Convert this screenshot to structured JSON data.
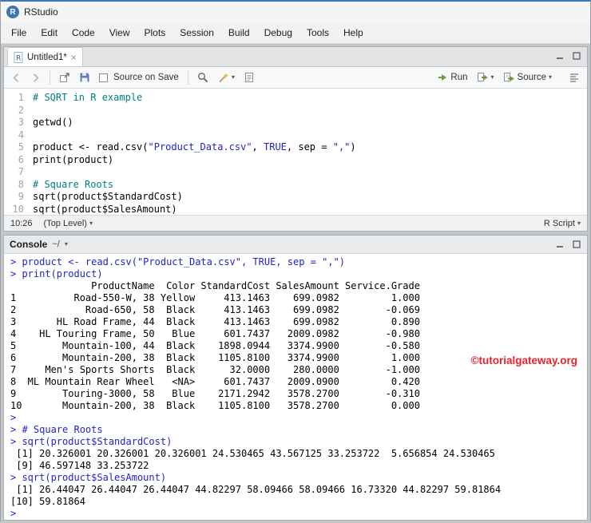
{
  "colors": {
    "accent": "#75aadb",
    "comment": "#008080",
    "code-blue": "#2222cc",
    "green": "#6a9e3a",
    "watermark-red": "#e8222a"
  },
  "window": {
    "title": "RStudio"
  },
  "menu": [
    "File",
    "Edit",
    "Code",
    "View",
    "Plots",
    "Session",
    "Build",
    "Debug",
    "Tools",
    "Help"
  ],
  "source_pane": {
    "tab_label": "Untitled1*",
    "toolbar": {
      "source_on_save": "Source on Save",
      "run": "Run",
      "source": "Source"
    },
    "status": {
      "cursor": "10:26",
      "scope": "(Top Level)",
      "file_type": "R Script"
    },
    "code": [
      {
        "num": "1",
        "seg": [
          {
            "t": "c",
            "x": "# SQRT in R example"
          }
        ]
      },
      {
        "num": "2",
        "seg": []
      },
      {
        "num": "3",
        "seg": [
          {
            "t": "p",
            "x": "getwd()"
          }
        ]
      },
      {
        "num": "4",
        "seg": []
      },
      {
        "num": "5",
        "seg": [
          {
            "t": "p",
            "x": "product <- read.csv("
          },
          {
            "t": "s",
            "x": "\"Product_Data.csv\""
          },
          {
            "t": "p",
            "x": ", "
          },
          {
            "t": "k",
            "x": "TRUE"
          },
          {
            "t": "p",
            "x": ", sep = "
          },
          {
            "t": "s",
            "x": "\",\""
          },
          {
            "t": "p",
            "x": ")"
          }
        ]
      },
      {
        "num": "6",
        "seg": [
          {
            "t": "p",
            "x": "print(product)"
          }
        ]
      },
      {
        "num": "7",
        "seg": []
      },
      {
        "num": "8",
        "seg": [
          {
            "t": "c",
            "x": "# Square Roots"
          }
        ]
      },
      {
        "num": "9",
        "seg": [
          {
            "t": "p",
            "x": "sqrt(product$StandardCost)"
          }
        ]
      },
      {
        "num": "10",
        "seg": [
          {
            "t": "p",
            "x": "sqrt(product$SalesAmount)"
          }
        ]
      }
    ]
  },
  "console": {
    "title": "Console",
    "path": "~/",
    "lines": [
      {
        "t": "in",
        "x": "> product <- read.csv(\"Product_Data.csv\", TRUE, sep = \",\")"
      },
      {
        "t": "in",
        "x": "> print(product)"
      },
      {
        "t": "out",
        "x": "              ProductName  Color StandardCost SalesAmount Service.Grade"
      },
      {
        "t": "out",
        "x": "1          Road-550-W, 38 Yellow     413.1463    699.0982         1.000"
      },
      {
        "t": "out",
        "x": "2            Road-650, 58  Black     413.1463    699.0982        -0.069"
      },
      {
        "t": "out",
        "x": "3       HL Road Frame, 44  Black     413.1463    699.0982         0.890"
      },
      {
        "t": "out",
        "x": "4    HL Touring Frame, 50   Blue     601.7437   2009.0982        -0.980"
      },
      {
        "t": "out",
        "x": "5        Mountain-100, 44  Black    1898.0944   3374.9900        -0.580"
      },
      {
        "t": "out",
        "x": "6        Mountain-200, 38  Black    1105.8100   3374.9900         1.000"
      },
      {
        "t": "out",
        "x": "7     Men's Sports Shorts  Black      32.0000    280.0000        -1.000"
      },
      {
        "t": "out",
        "x": "8  ML Mountain Rear Wheel   <NA>     601.7437   2009.0900         0.420"
      },
      {
        "t": "out",
        "x": "9        Touring-3000, 58   Blue    2171.2942   3578.2700        -0.310"
      },
      {
        "t": "out",
        "x": "10       Mountain-200, 38  Black    1105.8100   3578.2700         0.000"
      },
      {
        "t": "in",
        "x": "> "
      },
      {
        "t": "in",
        "x": "> # Square Roots"
      },
      {
        "t": "in",
        "x": "> sqrt(product$StandardCost)"
      },
      {
        "t": "out",
        "x": " [1] 20.326001 20.326001 20.326001 24.530465 43.567125 33.253722  5.656854 24.530465"
      },
      {
        "t": "out",
        "x": " [9] 46.597148 33.253722"
      },
      {
        "t": "in",
        "x": "> sqrt(product$SalesAmount)"
      },
      {
        "t": "out",
        "x": " [1] 26.44047 26.44047 26.44047 44.82297 58.09466 58.09466 16.73320 44.82297 59.81864"
      },
      {
        "t": "out",
        "x": "[10] 59.81864"
      },
      {
        "t": "in",
        "x": "> "
      }
    ]
  },
  "watermark": "©tutorialgateway.org"
}
